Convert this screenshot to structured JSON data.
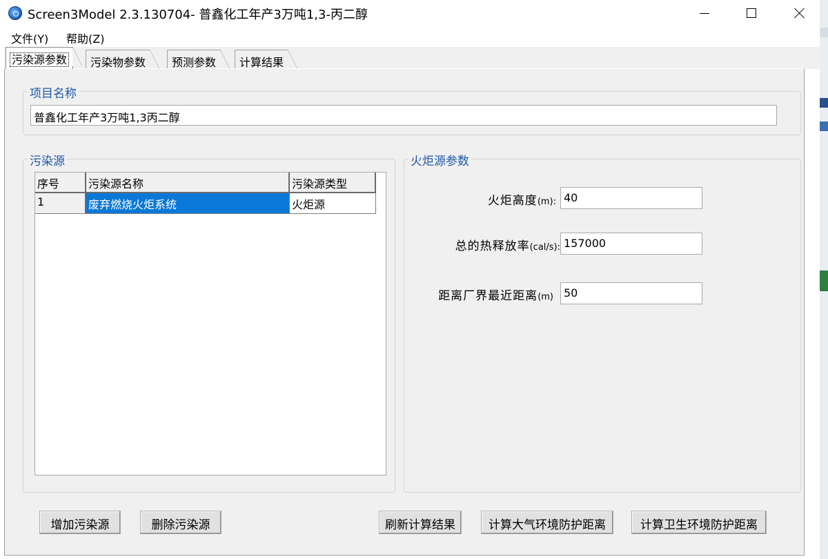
{
  "window": {
    "title": "Screen3Model 2.3.130704- 普鑫化工年产3万吨1,3-丙二醇",
    "controls": {
      "minimize": "minimize-icon",
      "maximize": "maximize-icon",
      "close": "close-icon"
    }
  },
  "menu": [
    {
      "label": "文件(Y)"
    },
    {
      "label": "帮助(Z)"
    }
  ],
  "tabs": [
    {
      "label": "污染源参数",
      "active": true
    },
    {
      "label": "污染物参数",
      "active": false
    },
    {
      "label": "预测参数",
      "active": false
    },
    {
      "label": "计算结果",
      "active": false
    }
  ],
  "project": {
    "group_title": "项目名称",
    "name_value": "普鑫化工年产3万吨1,3丙二醇"
  },
  "sources": {
    "group_title": "污染源",
    "columns": [
      "序号",
      "污染源名称",
      "污染源类型"
    ],
    "rows": [
      {
        "index": "1",
        "name": "废弃燃烧火炬系统",
        "type": "火炬源",
        "selected": true
      }
    ]
  },
  "flare": {
    "group_title": "火炬源参数",
    "fields": [
      {
        "label": "火炬高度",
        "unit": "(m):",
        "value": "40"
      },
      {
        "label": "总的热释放率",
        "unit": "(cal/s):",
        "value": "157000"
      },
      {
        "label": "距离厂界最近距离",
        "unit": "(m)",
        "value": "50"
      }
    ]
  },
  "buttons": {
    "add_source": "增加污染源",
    "delete_source": "删除污染源",
    "refresh_results": "刷新计算结果",
    "calc_atmospheric": "计算大气环境防护距离",
    "calc_sanitary": "计算卫生环境防护距离"
  },
  "colors": {
    "group_title": "#1e5aa8",
    "selection": "#0a78d7"
  }
}
